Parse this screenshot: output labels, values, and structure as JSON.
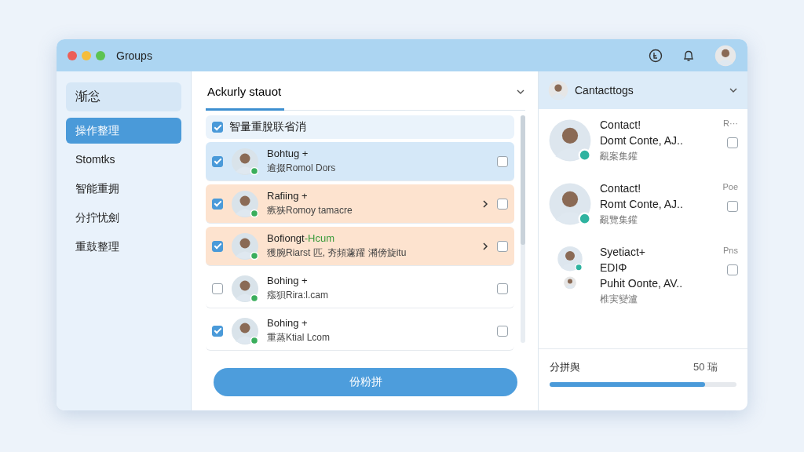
{
  "window": {
    "title": "Groups"
  },
  "sidebar": {
    "header": "渐忩",
    "items": [
      {
        "label": "操作整理",
        "selected": true
      },
      {
        "label": "Stomtks",
        "selected": false
      },
      {
        "label": "智能重拥",
        "selected": false
      },
      {
        "label": "分拧忧劍",
        "selected": false
      },
      {
        "label": "重鼓整理",
        "selected": false
      }
    ]
  },
  "list": {
    "tab": "Ackurly stauot",
    "select_all": {
      "label": "智量重脫联省消",
      "checked": true
    },
    "rows": [
      {
        "name": "Bohtug +",
        "detail": "逾掇Romol Dors",
        "checked": true,
        "kind": "selected",
        "flag": false
      },
      {
        "name": "Rafiing +",
        "detail": "瘚狭Romoy tamacre",
        "checked": true,
        "kind": "highlight",
        "flag": false
      },
      {
        "name": "Bofiongt",
        "name_extra": "-Hcum",
        "detail": "獲腕Riarst 匹, 夯頻蘧躍 潲傍旋itu",
        "checked": true,
        "kind": "highlight",
        "flag": false
      },
      {
        "name": "Bohing +",
        "detail": "瘬狽Rira:l.cam",
        "checked": false,
        "kind": "plain",
        "flag": false
      },
      {
        "name": "Bohing +",
        "detail": "重蒸Ktial Lcom",
        "checked": true,
        "kind": "plain",
        "flag": false
      }
    ],
    "button": "份粉拼"
  },
  "contacts": {
    "header": "Cantacttogs",
    "items": [
      {
        "title": "Contact!",
        "tag": "R···",
        "line": "Domt Conte, AJ..",
        "sub": "覶案集鑵",
        "checked": false
      },
      {
        "title": "Contact!",
        "tag": "Poe",
        "line": "Romt Conte, AJ..",
        "sub": "覶覽集鑵",
        "checked": false
      },
      {
        "title": "Syetiact+",
        "tag": "Pns",
        "extra": "EDΙΦ",
        "line": "Puhit Oonte, AV..",
        "sub": "椎実變瀘",
        "checked": false
      }
    ],
    "footer": {
      "label": "分拼舆",
      "value": "50 瑞",
      "level": 0.83
    }
  }
}
